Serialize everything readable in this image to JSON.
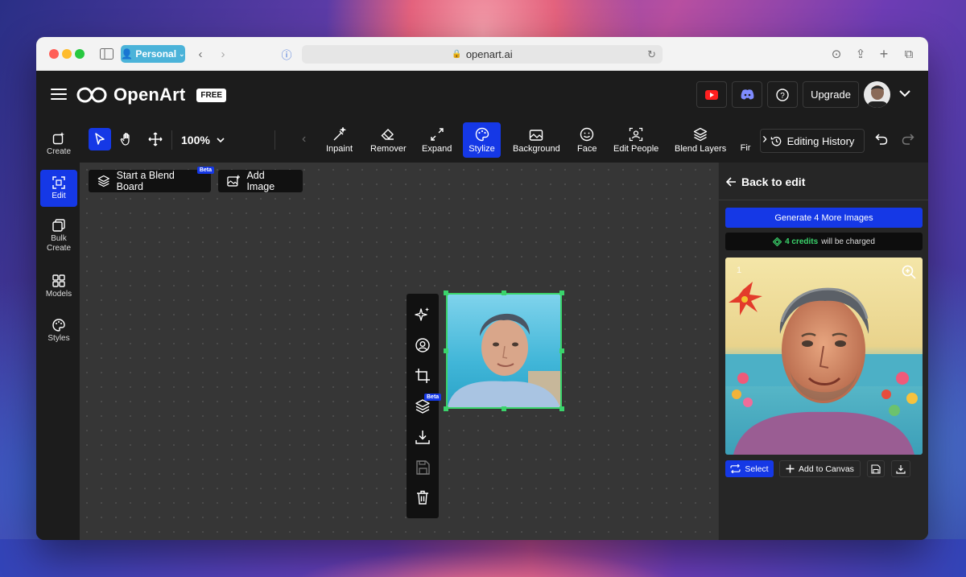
{
  "browser": {
    "profile_label": "Personal",
    "url": "openart.ai"
  },
  "header": {
    "logo_text": "OpenArt",
    "plan_badge": "FREE",
    "upgrade_label": "Upgrade"
  },
  "sidebar": {
    "items": [
      {
        "label": "Create",
        "icon": "sparkle-plus-icon"
      },
      {
        "label": "Edit",
        "icon": "edit-frame-icon",
        "active": true
      },
      {
        "label": "Bulk\nCreate",
        "icon": "copy-icon"
      },
      {
        "label": "Models",
        "icon": "grid-icon"
      },
      {
        "label": "Styles",
        "icon": "palette-icon"
      }
    ]
  },
  "toolbar": {
    "zoom_value": "100%",
    "tools": [
      {
        "label": "Inpaint"
      },
      {
        "label": "Remover"
      },
      {
        "label": "Expand"
      },
      {
        "label": "Stylize",
        "active": true
      },
      {
        "label": "Background"
      },
      {
        "label": "Face"
      },
      {
        "label": "Edit People"
      },
      {
        "label": "Blend Layers"
      },
      {
        "label": "Fir"
      }
    ],
    "editing_history_label": "Editing History"
  },
  "canvas": {
    "blend_board_label": "Start a Blend Board",
    "beta_label": "Beta",
    "add_image_label": "Add Image"
  },
  "right_panel": {
    "back_label": "Back to edit",
    "generate_label": "Generate 4 More Images",
    "credits_amount": "4 credits",
    "credits_suffix": "will be charged",
    "result_index": "1",
    "select_label": "Select",
    "add_to_canvas_label": "Add to Canvas"
  },
  "colors": {
    "accent": "#1538e6",
    "selection": "#3ad36b",
    "credits": "#3ad36b"
  }
}
